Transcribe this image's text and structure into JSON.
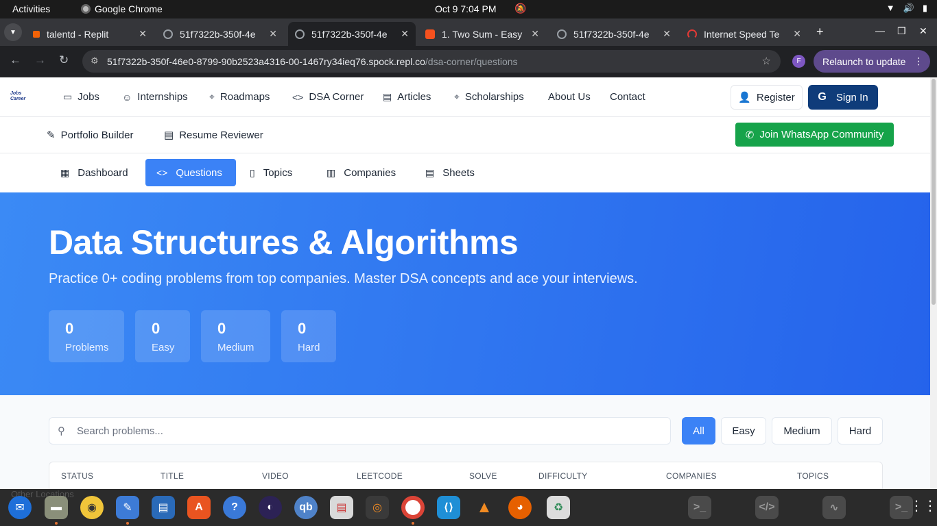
{
  "system": {
    "activities": "Activities",
    "app_name": "Google Chrome",
    "clock": "Oct 9  7:04 PM"
  },
  "tabs": [
    {
      "label": "talentd - Replit",
      "favicon_color": "#f26207"
    },
    {
      "label": "51f7322b-350f-4e",
      "favicon_color": "#9aa0a6"
    },
    {
      "label": "51f7322b-350f-4e",
      "favicon_color": "#9aa0a6",
      "active": true
    },
    {
      "label": "1. Two Sum - Easy",
      "favicon_color": "#f5511e"
    },
    {
      "label": "51f7322b-350f-4e",
      "favicon_color": "#9aa0a6"
    },
    {
      "label": "Internet Speed Te",
      "favicon_color": "#e53935"
    }
  ],
  "address": {
    "host": "51f7322b-350f-46e0-8799-90b2523a4316-00-1467ry34ieq76.spock.repl.co",
    "path": "/dsa-corner/questions",
    "profile_initial": "F",
    "relaunch": "Relaunch to update"
  },
  "header": {
    "logo_text": "Jobs Career",
    "nav": [
      {
        "label": "Jobs",
        "icon": "briefcase-icon"
      },
      {
        "label": "Internships",
        "icon": "users-icon"
      },
      {
        "label": "Roadmaps",
        "icon": "map-pin-icon"
      },
      {
        "label": "DSA Corner",
        "icon": "code-icon"
      },
      {
        "label": "Articles",
        "icon": "file-icon"
      },
      {
        "label": "Scholarships",
        "icon": "map-pin-icon"
      },
      {
        "label": "About Us",
        "icon": ""
      },
      {
        "label": "Contact",
        "icon": ""
      }
    ],
    "register": "Register",
    "sign_in": "Sign In"
  },
  "subheader": {
    "portfolio": "Portfolio Builder",
    "resume": "Resume Reviewer",
    "whatsapp": "Join WhatsApp Community"
  },
  "dsa_tabs": [
    {
      "label": "Dashboard",
      "icon": "grid-icon"
    },
    {
      "label": "Questions",
      "icon": "code-icon",
      "active": true
    },
    {
      "label": "Topics",
      "icon": "book-icon"
    },
    {
      "label": "Companies",
      "icon": "building-icon"
    },
    {
      "label": "Sheets",
      "icon": "file-icon"
    }
  ],
  "hero": {
    "title": "Data Structures & Algorithms",
    "subtitle": "Practice 0+ coding problems from top companies. Master DSA concepts and ace your interviews.",
    "stats": [
      {
        "value": "0",
        "label": "Problems"
      },
      {
        "value": "0",
        "label": "Easy"
      },
      {
        "value": "0",
        "label": "Medium"
      },
      {
        "value": "0",
        "label": "Hard"
      }
    ]
  },
  "filters": {
    "search_placeholder": "Search problems...",
    "buttons": [
      "All",
      "Easy",
      "Medium",
      "Hard"
    ],
    "active": "All"
  },
  "table": {
    "columns": [
      "STATUS",
      "TITLE",
      "VIDEO",
      "LEETCODE",
      "SOLVE",
      "DIFFICULTY",
      "COMPANIES",
      "TOPICS"
    ]
  },
  "dock": {
    "other_locations": "Other Locations"
  },
  "colors": {
    "primary": "#3b82f6",
    "navy": "#0f3c7a",
    "whatsapp": "#16a34a"
  }
}
